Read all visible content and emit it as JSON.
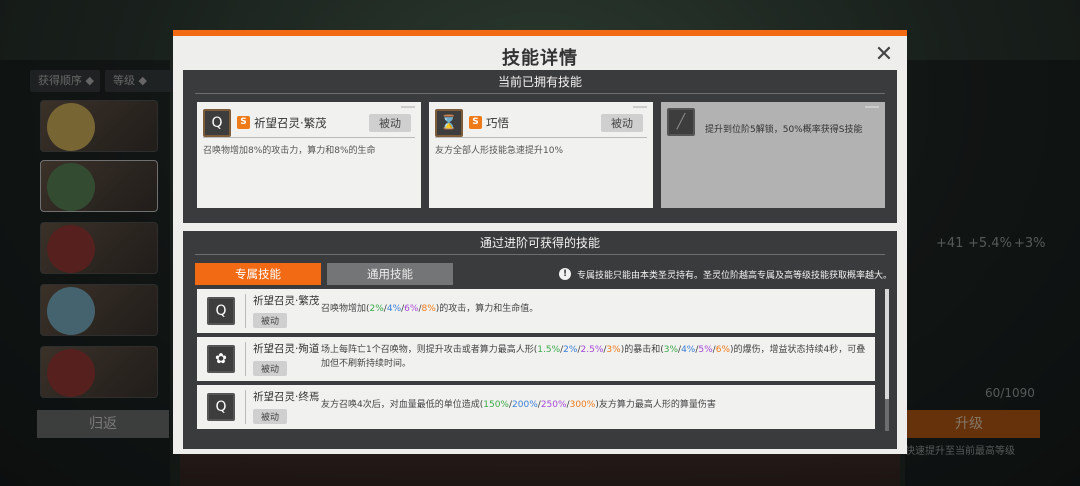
{
  "background": {
    "sort_label": "获得顺序",
    "level_label": "等级",
    "back_label": "归返",
    "upgrade_label": "升级",
    "upgrade_hint": "快速提升至当前最高等级",
    "exp_text": "60/1090",
    "stat_1": "+41",
    "stat_2": "+5.4%",
    "stat_3": "+3%"
  },
  "modal": {
    "title": "技能详情",
    "close_icon": "close-icon"
  },
  "owned": {
    "header": "当前已拥有技能",
    "cards": [
      {
        "name": "祈望召灵·繁茂",
        "badge": "S",
        "type": "被动",
        "desc": "召唤物增加8%的攻击力，算力和8%的生命",
        "icon": "Q"
      },
      {
        "name": "巧悟",
        "badge": "S",
        "type": "被动",
        "desc": "友方全部人形技能急速提升10%",
        "icon": "⌛"
      }
    ],
    "locked_text": "提升到位阶5解锁，50%概率获得S技能"
  },
  "obtainable": {
    "header": "通过进阶可获得的技能",
    "tab_exclusive": "专属技能",
    "tab_general": "通用技能",
    "notice": "专属技能只能由本类圣灵持有。圣灵位阶越高专属及高等级技能获取概率越大。",
    "items": [
      {
        "name": "祈望召灵·繁茂",
        "type": "被动",
        "desc_pre": "召唤物增加(",
        "v1": "2%",
        "v2": "4%",
        "v3": "6%",
        "v4": "8%",
        "desc_post": ")的攻击，算力和生命值。"
      },
      {
        "name": "祈望召灵·殉道",
        "type": "被动",
        "desc_pre": "场上每阵亡1个召唤物，则提升攻击或者算力最高人形(",
        "v1": "1.5%",
        "v2": "2%",
        "v3": "2.5%",
        "v4": "3%",
        "desc_mid": ")的暴击和(",
        "w1": "3%",
        "w2": "4%",
        "w3": "5%",
        "w4": "6%",
        "desc_post": ")的爆伤，增益状态持续4秒，可叠加但不刷新持续时间。"
      },
      {
        "name": "祈望召灵·终焉",
        "type": "被动",
        "desc_pre": "友方召唤4次后，对血量最低的单位造成(",
        "v1": "150%",
        "v2": "200%",
        "v3": "250%",
        "v4": "300%",
        "desc_post": ")友方算力最高人形的算量伤害"
      }
    ]
  },
  "colors": {
    "accent": "#f26a14",
    "tier1": "#3caa4a",
    "tier2": "#3a7fd8",
    "tier3": "#a64ad8",
    "tier4": "#ef7a1a"
  }
}
